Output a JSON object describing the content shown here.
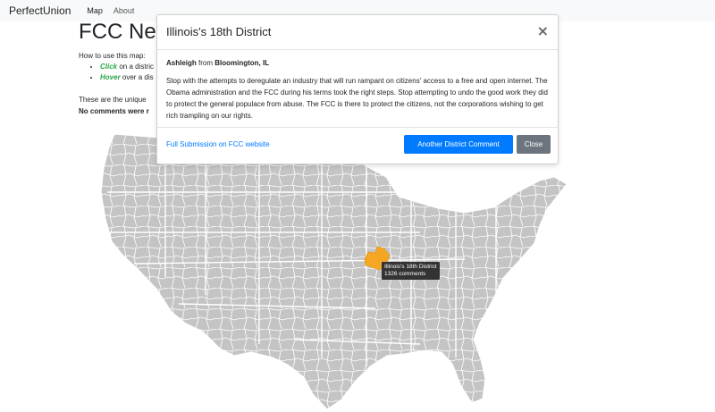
{
  "navbar": {
    "brand": "PerfectUnion",
    "links": [
      "Map",
      "About"
    ]
  },
  "page": {
    "title": "FCC Net",
    "intro": "How to use this map:",
    "howto": [
      {
        "verb": "Click",
        "rest": " on a distric"
      },
      {
        "verb": "Hover",
        "rest": " over a dis"
      }
    ],
    "unique_note": "These are the unique",
    "no_comments_note": "No comments were r"
  },
  "tooltip": {
    "district": "Illinois's 18th District",
    "count": "1326 comments"
  },
  "modal": {
    "title": "Illinois's 18th District",
    "close_label": "×",
    "commenter_name": "Ashleigh",
    "commenter_from": " from ",
    "commenter_location": "Bloomington, IL",
    "comment": "Stop with the attempts to deregulate an industry that will run rampant on citizens' access to a free and open internet. The Obama administration and the FCC during his terms took the right steps. Stop attempting to undo the good work they did to protect the general populace from abuse. The FCC is there to protect the citizens, not the corporations wishing to get rich trampling on our rights.",
    "full_link": "Full Submission on FCC website",
    "another_button": "Another District Comment",
    "close_button": "Close"
  },
  "colors": {
    "map_fill": "#c4c4c4",
    "map_border": "#ffffff",
    "highlight": "#f5a623",
    "primary": "#007bff",
    "secondary": "#6c757d",
    "accent_green": "#28a745"
  }
}
